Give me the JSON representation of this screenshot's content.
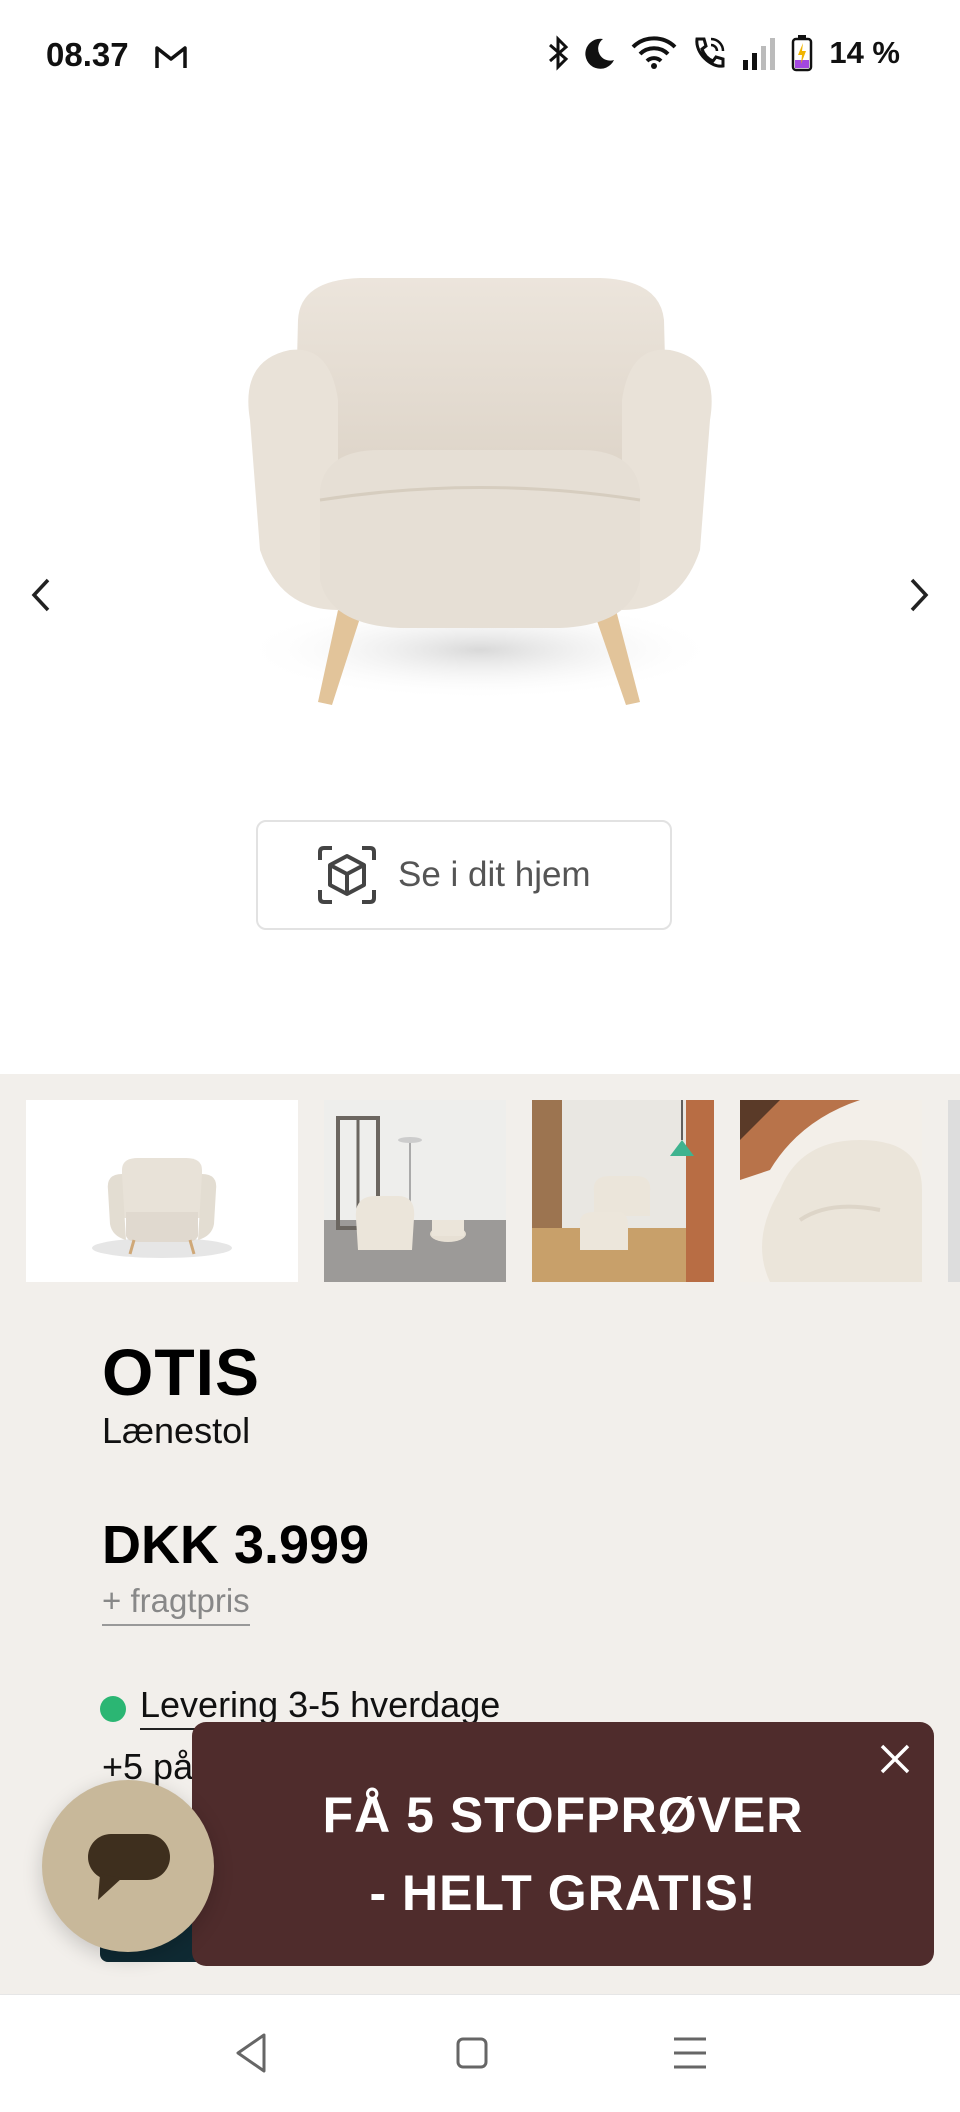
{
  "status_bar": {
    "time": "08.37",
    "battery": "14 %",
    "icons": [
      "gmail-icon",
      "bluetooth-icon",
      "do-not-disturb-moon-icon",
      "wifi-icon",
      "wifi-call-icon",
      "signal-icon",
      "battery-icon"
    ]
  },
  "hero": {
    "ar_button_label": "Se i dit hjem",
    "icons": [
      "chevron-left-icon",
      "chevron-right-icon",
      "ar-cube-icon"
    ]
  },
  "product": {
    "thumbnail_count": 5,
    "title": "OTIS",
    "subtitle": "Lænestol",
    "price": "DKK 3.999",
    "shipping_link": "+ fragtpris",
    "delivery": "Levering 3-5 hverdage",
    "stock": "+5 på"
  },
  "promo": {
    "line1": "FÅ 5 STOFPRØVER",
    "line2": "- HELT GRATIS!"
  },
  "colors": {
    "section_bg": "#f2efeb",
    "promo_bg": "#4f2c2c",
    "chat_bg": "#c8b89a",
    "delivery_dot": "#2bb673",
    "cart_button": "#0f2a33"
  }
}
